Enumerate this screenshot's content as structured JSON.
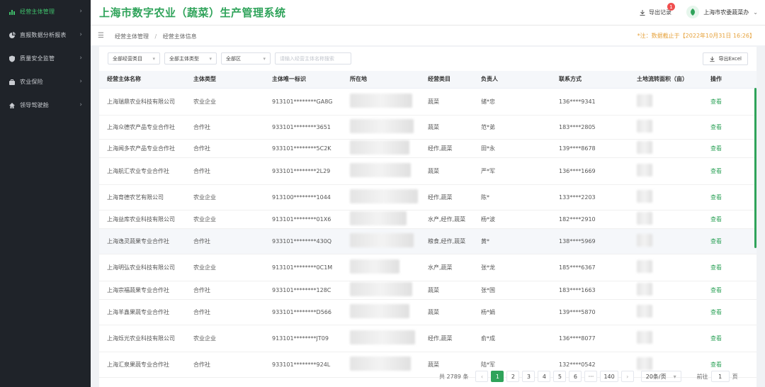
{
  "sidebar": {
    "items": [
      {
        "label": "经营主体管理",
        "icon": "bar-chart-icon",
        "active": true
      },
      {
        "label": "直报数据分析报表",
        "icon": "pie-chart-icon",
        "active": false
      },
      {
        "label": "质量安全监管",
        "icon": "shield-icon",
        "active": false
      },
      {
        "label": "农业保险",
        "icon": "briefcase-icon",
        "active": false
      },
      {
        "label": "领导驾驶舱",
        "icon": "home-icon",
        "active": false
      }
    ]
  },
  "header": {
    "title": "上海市数字农业（蔬菜）生产管理系统",
    "export_records": "导出记录",
    "badge_count": "1",
    "user_name": "上海市农委蔬菜办"
  },
  "breadcrumb": {
    "items": [
      "经营主体管理",
      "经营主体信息"
    ],
    "note": "*注：数据截止于【2022年10月31日 16:26】"
  },
  "filters": {
    "category": "全部经营类目",
    "entity_type": "全部主体类型",
    "district": "全部区",
    "search_placeholder": "请输入经营主体名称搜索",
    "export_excel": "导出Excel"
  },
  "table": {
    "columns": [
      "经营主体名称",
      "主体类型",
      "主体唯一标识",
      "所在地",
      "经营类目",
      "负责人",
      "联系方式",
      "土地流转面积（亩）",
      "操作"
    ],
    "action_label": "查看",
    "rows": [
      {
        "name": "上海瑞鼎农业科技有限公司",
        "type": "农业企业",
        "id": "913101********GA8G",
        "category": "蔬菜",
        "owner": "储*忠",
        "phone": "136****9341"
      },
      {
        "name": "上海众德农产品专业合作社",
        "type": "合作社",
        "id": "933101********3651",
        "category": "蔬菜",
        "owner": "范*弟",
        "phone": "183****2805"
      },
      {
        "name": "上海闻多农产品专业合作社",
        "type": "合作社",
        "id": "933101********5C2K",
        "category": "经作,蔬菜",
        "owner": "田*永",
        "phone": "139****8678"
      },
      {
        "name": "上海航汇农业专业合作社",
        "type": "合作社",
        "id": "933101********2L29",
        "category": "蔬菜",
        "owner": "严*军",
        "phone": "136****1669"
      },
      {
        "name": "上海育德农艺有限公司",
        "type": "农业企业",
        "id": "913100********1044",
        "category": "经作,蔬菜",
        "owner": "陈*",
        "phone": "133****2203"
      },
      {
        "name": "上海益库农业科技有限公司",
        "type": "农业企业",
        "id": "913101********01X6",
        "category": "水产,经作,蔬菜",
        "owner": "杨*波",
        "phone": "182****2910"
      },
      {
        "name": "上海逸灵蔬果专业合作社",
        "type": "合作社",
        "id": "933101********430Q",
        "category": "粮食,经作,蔬菜",
        "owner": "黄*",
        "phone": "138****5969"
      },
      {
        "name": "上海明弘农业科技有限公司",
        "type": "农业企业",
        "id": "913101********0C1M",
        "category": "水产,蔬菜",
        "owner": "张*龙",
        "phone": "185****6367"
      },
      {
        "name": "上海宗福蔬果专业合作社",
        "type": "合作社",
        "id": "933101********128C",
        "category": "蔬菜",
        "owner": "张*国",
        "phone": "183****1663"
      },
      {
        "name": "上海羊鑫果蔬专业合作社",
        "type": "合作社",
        "id": "933101********D566",
        "category": "蔬菜",
        "owner": "杨*娟",
        "phone": "139****5870"
      },
      {
        "name": "上海烁光农业科技有限公司",
        "type": "农业企业",
        "id": "913101********JT09",
        "category": "经作,蔬菜",
        "owner": "俞*成",
        "phone": "136****8077"
      },
      {
        "name": "上海汇泉果蔬专业合作社",
        "type": "合作社",
        "id": "933101********924L",
        "category": "蔬菜",
        "owner": "陆*军",
        "phone": "132****0542"
      }
    ]
  },
  "pagination": {
    "total": "共 2789 条",
    "pages": [
      "1",
      "2",
      "3",
      "4",
      "5",
      "6"
    ],
    "ellipsis": "···",
    "last_page": "140",
    "page_size": "20条/页",
    "goto_label": "前往",
    "goto_value": "1",
    "goto_suffix": "页"
  },
  "colors": {
    "brand": "#2fa35a",
    "sidebar_bg": "#1f2329",
    "note": "#e6a23c",
    "badge": "#f04f4f"
  }
}
